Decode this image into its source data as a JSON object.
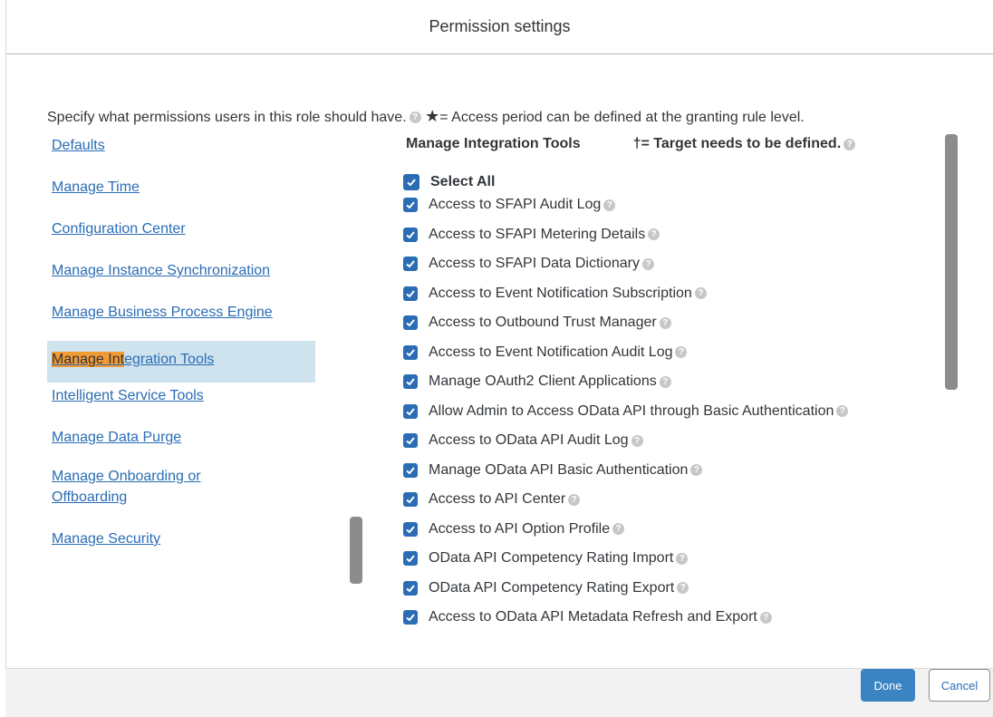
{
  "dialog": {
    "title": "Permission settings",
    "intro_text": "Specify what permissions users in this role should have.",
    "star_note": "= Access period can be defined at the granting rule level."
  },
  "nav": {
    "items": [
      {
        "label": "Defaults"
      },
      {
        "label": "Manage Time"
      },
      {
        "label": "Configuration Center"
      },
      {
        "label": "Manage Instance Synchronization"
      },
      {
        "label": "Manage Business Process Engine"
      },
      {
        "label_highlight": "Manage Int",
        "label_rest": "egration Tools"
      },
      {
        "label": "Intelligent Service Tools"
      },
      {
        "label": "Manage Data Purge"
      },
      {
        "label_line1": "Manage Onboarding or",
        "label_line2": "Offboarding"
      },
      {
        "label": "Manage Security"
      }
    ]
  },
  "panel": {
    "title": "Manage Integration Tools",
    "target_note": "†= Target needs to be defined.",
    "select_all": "Select All",
    "permissions": [
      "Access to SFAPI Audit Log",
      "Access to SFAPI Metering Details",
      "Access to SFAPI Data Dictionary",
      "Access to Event Notification Subscription",
      "Access to Outbound Trust Manager",
      "Access to Event Notification Audit Log",
      "Manage OAuth2 Client Applications",
      "Allow Admin to Access OData API through Basic Authentication",
      "Access to OData API Audit Log",
      "Manage OData API Basic Authentication",
      "Access to API Center",
      "Access to API Option Profile",
      "OData API Competency Rating Import",
      "OData API Competency Rating Export",
      "Access to OData API Metadata Refresh and Export"
    ]
  },
  "footer": {
    "done_label": "Done",
    "cancel_label": "Cancel"
  },
  "colors": {
    "accent": "#2a6db5",
    "highlight": "#f29b35",
    "active_nav_bg": "#cfe3ef"
  }
}
